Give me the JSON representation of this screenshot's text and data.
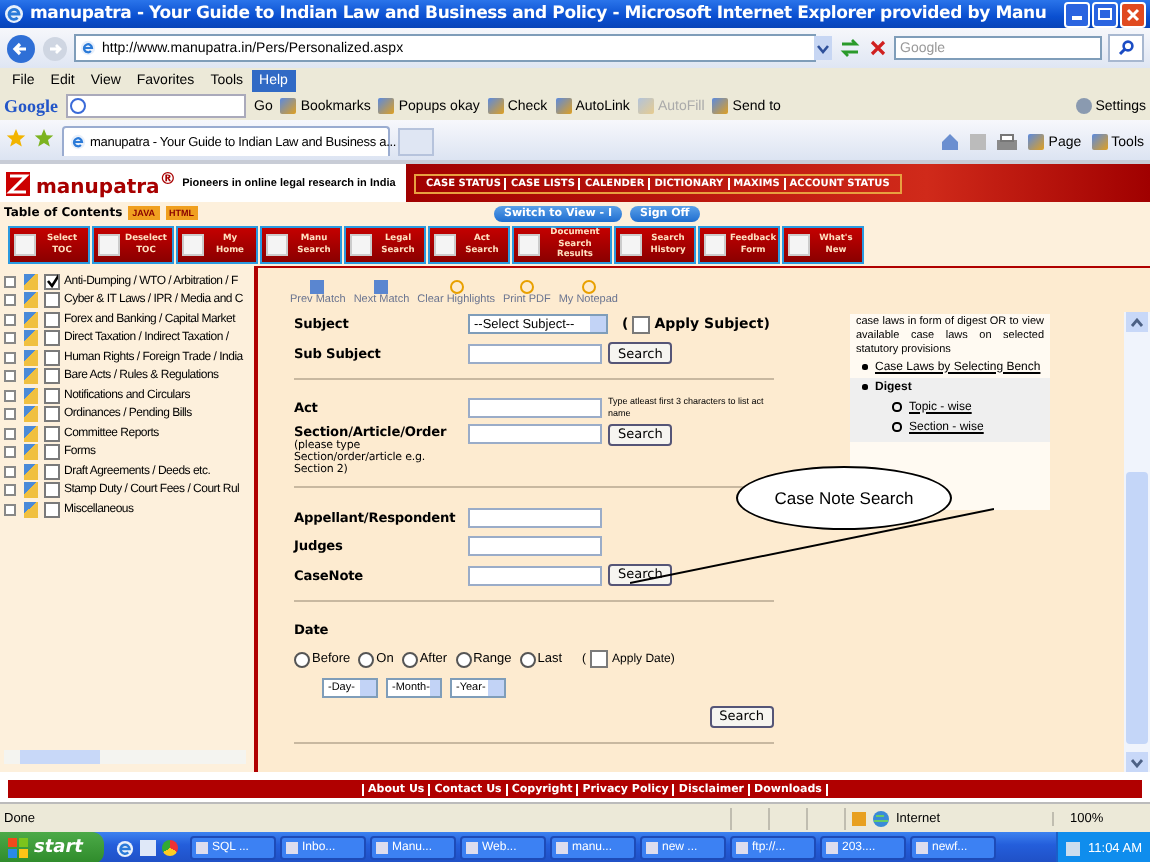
{
  "window": {
    "title": "manupatra - Your Guide to Indian Law and Business and Policy - Microsoft Internet Explorer provided by Manu"
  },
  "address_bar": {
    "url": "http://www.manupatra.in/Pers/Personalized.aspx",
    "search_placeholder": "Google"
  },
  "menu": [
    {
      "label": "File",
      "selected": false
    },
    {
      "label": "Edit",
      "selected": false
    },
    {
      "label": "View",
      "selected": false
    },
    {
      "label": "Favorites",
      "selected": false
    },
    {
      "label": "Tools",
      "selected": false
    },
    {
      "label": "Help",
      "selected": true
    }
  ],
  "google_toolbar": {
    "brand": "Google",
    "go": "Go",
    "items": [
      {
        "label": "Bookmarks",
        "disabled": false
      },
      {
        "label": "Popups okay",
        "disabled": false
      },
      {
        "label": "Check",
        "disabled": false
      },
      {
        "label": "AutoLink",
        "disabled": false
      },
      {
        "label": "AutoFill",
        "disabled": true
      },
      {
        "label": "Send to",
        "disabled": false
      }
    ],
    "settings": "Settings"
  },
  "tabs": [
    {
      "label": "manupatra - Your Guide to Indian Law and Business a...",
      "selected": true
    }
  ],
  "command_bar": [
    "Page",
    "Tools"
  ],
  "site": {
    "logo": "manupatra$^{®}$",
    "tagline": "Pioneers in online legal research in India",
    "top_links": [
      "CASE STATUS",
      "CASE LISTS",
      "CALENDER",
      "DICTIONARY",
      "MAXIMS",
      "ACCOUNT STATUS"
    ]
  },
  "toc": {
    "title": "Table of Contents",
    "formats": [
      "JAVA",
      "HTML"
    ]
  },
  "account_buttons": [
    "Switch to View - I",
    "Sign Off"
  ],
  "nav": [
    "Select TOC",
    "Deselect TOC",
    "My Home",
    "Manu Search",
    "Legal Search",
    "Act Search",
    "Document Search Results",
    "Search History",
    "Feedback Form",
    "What's New"
  ],
  "tree": [
    {
      "label": "Anti-Dumping / WTO / Arbitration / F",
      "checked": true
    },
    {
      "label": "Cyber & IT Laws / IPR / Media and C",
      "checked": false
    },
    {
      "label": "Forex and Banking / Capital Market",
      "checked": false
    },
    {
      "label": "Direct Taxation / Indirect Taxation /",
      "checked": false
    },
    {
      "label": "Human Rights / Foreign Trade / India",
      "checked": false
    },
    {
      "label": "Bare Acts / Rules & Regulations",
      "checked": false
    },
    {
      "label": "Notifications and Circulars",
      "checked": false
    },
    {
      "label": "Ordinances / Pending Bills",
      "checked": false
    },
    {
      "label": "Committee Reports",
      "checked": false
    },
    {
      "label": "Forms",
      "checked": false
    },
    {
      "label": "Draft Agreements / Deeds etc.",
      "checked": false
    },
    {
      "label": "Stamp Duty / Court Fees / Court Rul",
      "checked": false
    },
    {
      "label": "Miscellaneous",
      "checked": false
    }
  ],
  "find_toolbar": [
    "Prev Match",
    "Next Match",
    "Clear Highlights",
    "Print PDF",
    "My Notepad"
  ],
  "form": {
    "subject": {
      "label": "Subject",
      "select": "--Select Subject--",
      "apply": {
        "open": "(",
        "label": "Apply Subject)",
        "checked": false
      }
    },
    "sub_subject": {
      "label": "Sub Subject",
      "button": "Search"
    },
    "act": {
      "label": "Act",
      "hint": "Type atleast first 3 characters to list act name"
    },
    "section": {
      "label": "Section/Article/Order",
      "note": "(please type Section/order/article e.g. Section 2)",
      "button": "Search"
    },
    "appellant": {
      "label": "Appellant/Respondent"
    },
    "judges": {
      "label": "Judges"
    },
    "casenote": {
      "label": "CaseNote",
      "button": "Search"
    },
    "date": {
      "label": "Date",
      "options": [
        {
          "label": "Before",
          "selected": false
        },
        {
          "label": "On",
          "selected": false
        },
        {
          "label": "After",
          "selected": false
        },
        {
          "label": "Range",
          "selected": false
        },
        {
          "label": "Last",
          "selected": false
        }
      ],
      "apply": {
        "open": "(",
        "label": "Apply Date)",
        "checked": false
      },
      "selects": [
        "-Day-",
        "-Month-",
        "-Year-"
      ],
      "button": "Search"
    }
  },
  "info_panel": {
    "text": "case laws in form of digest OR to view available case laws on selected statutory provisions",
    "links": [
      "Case Laws by Selecting Bench"
    ],
    "digest": {
      "label": "Digest",
      "links": [
        "Topic - wise",
        "Section - wise"
      ]
    }
  },
  "callout": "Case Note Search",
  "footer": [
    "About Us",
    "Contact Us",
    "Copyright",
    "Privacy Policy",
    "Disclaimer",
    "Downloads"
  ],
  "status_bar": {
    "text": "Done",
    "zone": "Internet",
    "zoom": "100%"
  },
  "taskbar": {
    "start": "start",
    "items": [
      "SQL ...",
      "Inbo...",
      "Manu...",
      "Web...",
      "manu...",
      "new ...",
      "ftp://...",
      "203....",
      "newf..."
    ],
    "clock": "11:04 AM"
  }
}
